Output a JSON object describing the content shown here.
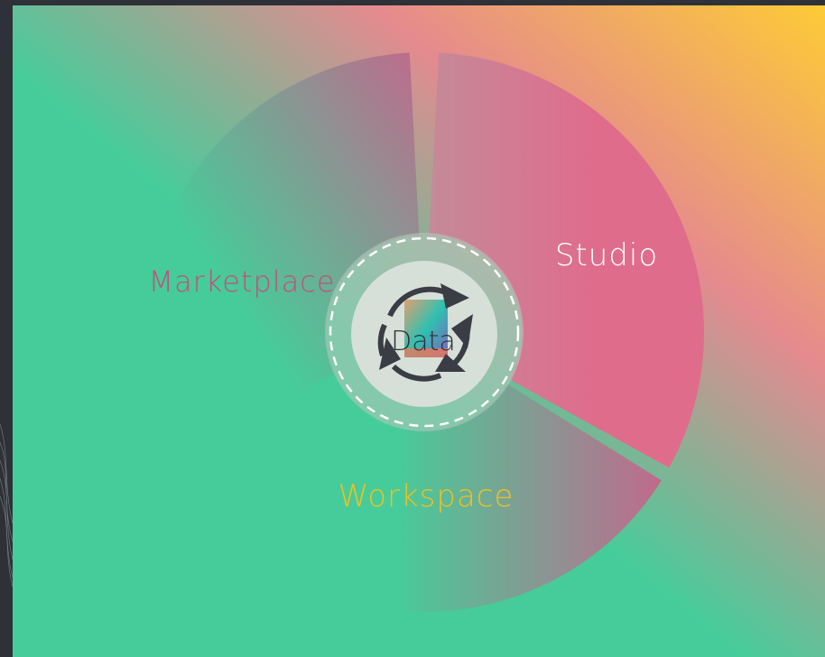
{
  "diagram": {
    "segments": [
      {
        "id": "studio",
        "label": "Studio",
        "label_color": "#ffffff"
      },
      {
        "id": "workspace",
        "label": "Workspace",
        "label_color": "#f0c020"
      },
      {
        "id": "marketplace",
        "label": "Marketplace",
        "label_color": "#c0507a"
      }
    ],
    "hub": {
      "label": "Data",
      "icon": "cycle-arrows-icon"
    },
    "colors": {
      "green": "#46cc9a",
      "pink": "#e06c8c",
      "yellow": "#fdcb36",
      "dark": "#2e3138",
      "hub_fill": "#d6e0d8"
    }
  }
}
